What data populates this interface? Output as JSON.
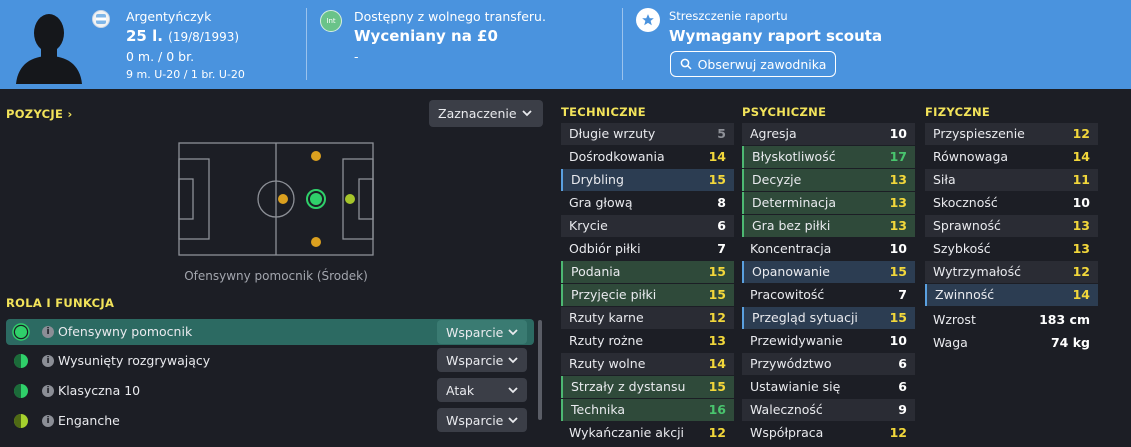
{
  "header": {
    "nationality": "Argentyńczyk",
    "age": "25 l.",
    "dob": "(19/8/1993)",
    "apps": "0 m. / 0 br.",
    "u20": "9 m. U-20 / 1 br. U-20",
    "int_badge": "Int",
    "transfer_status": "Dostępny z wolnego transferu.",
    "valuation": "Wyceniany na £0",
    "dash": "-",
    "report_title": "Streszczenie raportu",
    "report_needed": "Wymagany raport scouta",
    "watch_label": "Obserwuj zawodnika"
  },
  "positions": {
    "title": "POZYCJE",
    "selector": "Zaznaczenie",
    "caption": "Ofensywny pomocnik (Środek)"
  },
  "roles": {
    "title": "ROLA I FUNKCJA",
    "items": [
      {
        "name": "Ofensywny pomocnik",
        "duty": "Wsparcie",
        "color": "#2fd06a"
      },
      {
        "name": "Wysunięty rozgrywający",
        "duty": "Wsparcie",
        "color": "#2fd06a"
      },
      {
        "name": "Klasyczna 10",
        "duty": "Atak",
        "color": "#2fd06a"
      },
      {
        "name": "Enganche",
        "duty": "Wsparcie",
        "color": "#a6d12e"
      }
    ]
  },
  "attributes": {
    "technical": {
      "title": "TECHNICZNE",
      "items": [
        {
          "name": "Długie wrzuty",
          "value": "5"
        },
        {
          "name": "Dośrodkowania",
          "value": "14"
        },
        {
          "name": "Drybling",
          "value": "15"
        },
        {
          "name": "Gra głową",
          "value": "8"
        },
        {
          "name": "Krycie",
          "value": "6"
        },
        {
          "name": "Odbiór piłki",
          "value": "7"
        },
        {
          "name": "Podania",
          "value": "15"
        },
        {
          "name": "Przyjęcie piłki",
          "value": "15"
        },
        {
          "name": "Rzuty karne",
          "value": "12"
        },
        {
          "name": "Rzuty rożne",
          "value": "13"
        },
        {
          "name": "Rzuty wolne",
          "value": "14"
        },
        {
          "name": "Strzały z dystansu",
          "value": "15"
        },
        {
          "name": "Technika",
          "value": "16"
        },
        {
          "name": "Wykańczanie akcji",
          "value": "12"
        }
      ]
    },
    "mental": {
      "title": "PSYCHICZNE",
      "items": [
        {
          "name": "Agresja",
          "value": "10"
        },
        {
          "name": "Błyskotliwość",
          "value": "17"
        },
        {
          "name": "Decyzje",
          "value": "13"
        },
        {
          "name": "Determinacja",
          "value": "13"
        },
        {
          "name": "Gra bez piłki",
          "value": "13"
        },
        {
          "name": "Koncentracja",
          "value": "10"
        },
        {
          "name": "Opanowanie",
          "value": "15"
        },
        {
          "name": "Pracowitość",
          "value": "7"
        },
        {
          "name": "Przegląd sytuacji",
          "value": "15"
        },
        {
          "name": "Przewidywanie",
          "value": "10"
        },
        {
          "name": "Przywództwo",
          "value": "6"
        },
        {
          "name": "Ustawianie się",
          "value": "6"
        },
        {
          "name": "Waleczność",
          "value": "9"
        },
        {
          "name": "Współpraca",
          "value": "12"
        }
      ]
    },
    "physical": {
      "title": "FIZYCZNE",
      "items": [
        {
          "name": "Przyspieszenie",
          "value": "12"
        },
        {
          "name": "Równowaga",
          "value": "14"
        },
        {
          "name": "Siła",
          "value": "11"
        },
        {
          "name": "Skoczność",
          "value": "10"
        },
        {
          "name": "Sprawność",
          "value": "13"
        },
        {
          "name": "Szybkość",
          "value": "13"
        },
        {
          "name": "Wytrzymałość",
          "value": "12"
        },
        {
          "name": "Zwinność",
          "value": "14"
        }
      ],
      "height_label": "Wzrost",
      "height": "183 cm",
      "weight_label": "Waga",
      "weight": "74 kg"
    }
  }
}
